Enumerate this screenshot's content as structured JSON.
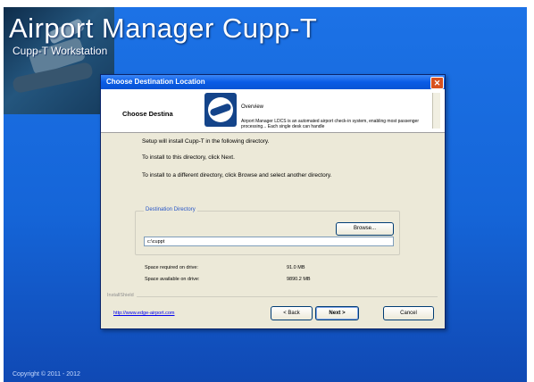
{
  "app": {
    "title": "Airport Manager Cupp-T",
    "subtitle": "Cupp-T Workstation",
    "copyright": "Copyright © 2011 - 2012"
  },
  "dialog": {
    "title": "Choose Destination Location",
    "close_symbol": "✕",
    "banner": {
      "heading": "Choose Destina",
      "overview_title": "Overview",
      "description": "Airport Manager LDCS is an automated airport check-in system, enabling most passenger processing... Each single desk can handle"
    },
    "lines": [
      "Setup will install Cupp-T in the following directory.",
      "To install to this directory, click Next.",
      "To install to a different directory, click Browse and select another directory."
    ],
    "destination": {
      "group_label": "Destination Directory",
      "browse_label": "Browse...",
      "path_value": "c:\\cuppt"
    },
    "space": {
      "required_label": "Space required on drive:",
      "required_value": "91.0 MB",
      "available_label": "Space available on drive:",
      "available_value": "9890.2 MB"
    },
    "brand": "InstallShield",
    "website": "http://www.edge-airport.com",
    "buttons": {
      "back": "< Back",
      "next": "Next >",
      "cancel": "Cancel"
    }
  },
  "colors": {
    "desktop_blue": "#1c72e6",
    "titlebar_blue": "#0a5ce6",
    "dialog_face": "#ece9d8",
    "close_red": "#d8511e",
    "link_blue": "#0000ee"
  }
}
